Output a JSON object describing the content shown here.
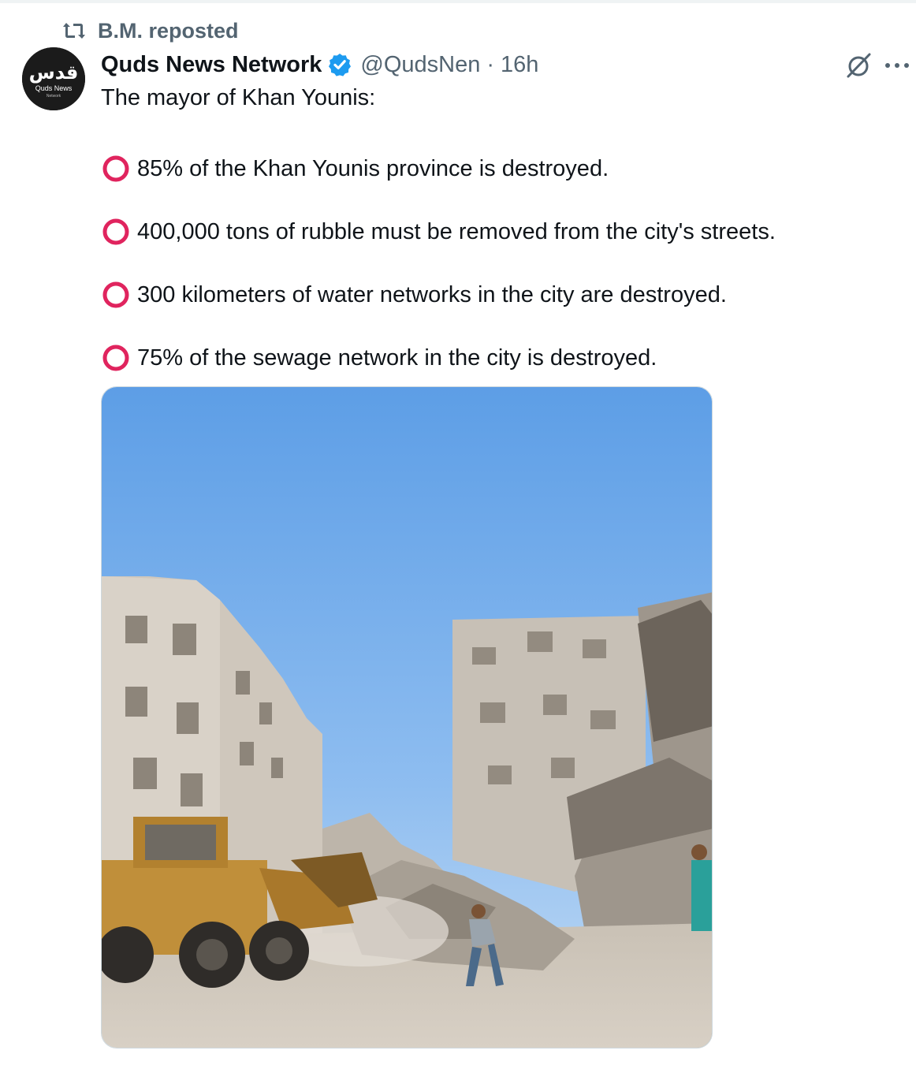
{
  "repost": {
    "label": "B.M. reposted",
    "icon": "repost-icon"
  },
  "author": {
    "avatar_name": "قدس",
    "avatar_sub": "Quds News",
    "avatar_sub2": "Network",
    "name": "Quds News Network",
    "handle": "@QudsNen",
    "separator": "·",
    "time": "16h",
    "verified_color": "#1d9bf0"
  },
  "tweet": {
    "intro": "The mayor of Khan Younis:",
    "bullets": [
      "85% of the Khan Younis province is destroyed.",
      "400,000 tons of rubble must be removed from the city's streets.",
      "300 kilometers of water networks in the city are destroyed.",
      "75% of the sewage network in the city is destroyed."
    ],
    "bullet_color": "#e0245e"
  },
  "media": {
    "description_icon": "photo-destroyed-street"
  },
  "actions": {
    "grok": "grok-icon",
    "more": "more-icon"
  }
}
